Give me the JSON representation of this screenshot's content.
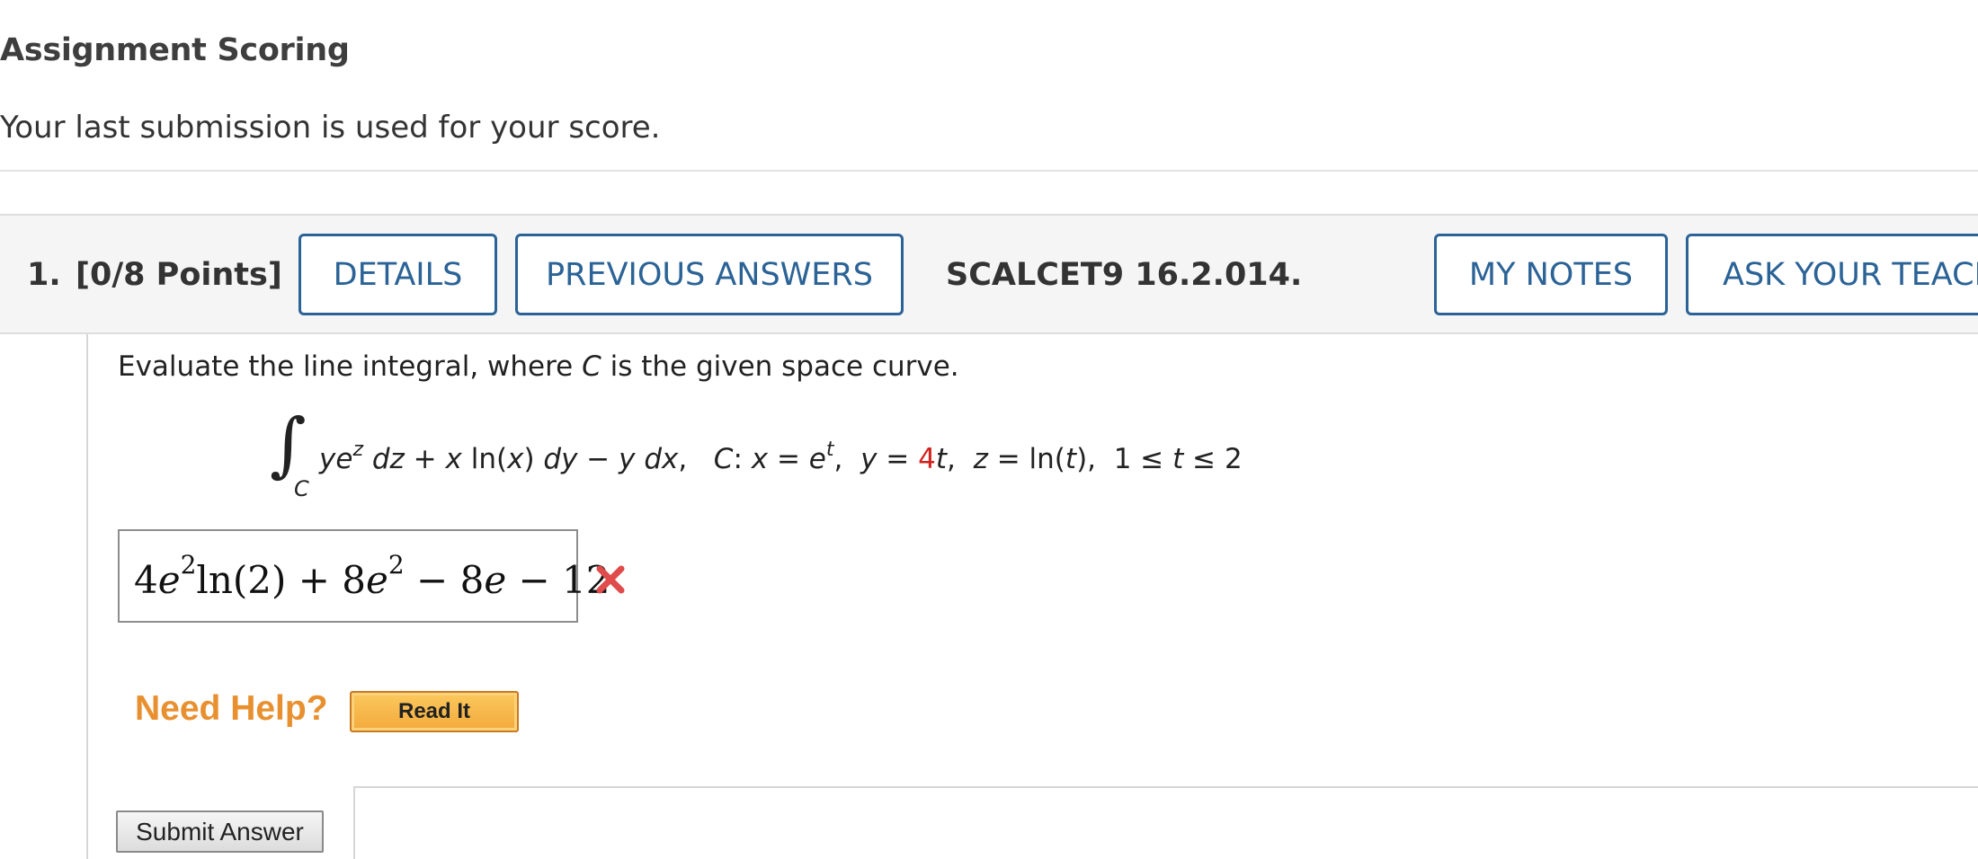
{
  "header": {
    "title": "Assignment Scoring",
    "subtitle": "Your last submission is used for your score."
  },
  "question": {
    "number": "1.",
    "points": "[0/8 Points]",
    "details_label": "DETAILS",
    "previous_answers_label": "PREVIOUS ANSWERS",
    "code": "SCALCET9 16.2.014.",
    "my_notes_label": "MY NOTES",
    "ask_teacher_label": "ASK YOUR TEACHER",
    "prompt_before": "Evaluate the line integral, where ",
    "prompt_var": "C",
    "prompt_after": " is the given space curve.",
    "integral": {
      "subscript": "C",
      "integrand": "ye^z dz + x ln(x) dy − y dx",
      "curve": "C: x = e^t, y = 4t, z = ln(t), 1 ≤ t ≤ 2",
      "highlight_value": "4"
    },
    "answer": "4e^2 ln(2) + 8e^2 − 8e − 12",
    "answer_status": "incorrect",
    "answer_status_icon": "x-icon",
    "help_label": "Need Help?",
    "read_it_label": "Read It",
    "submit_label": "Submit Answer"
  },
  "colors": {
    "button_border": "#2b6396",
    "help_orange": "#e8902f",
    "error_red": "#e04b4b",
    "highlight_red": "#d2231f"
  }
}
